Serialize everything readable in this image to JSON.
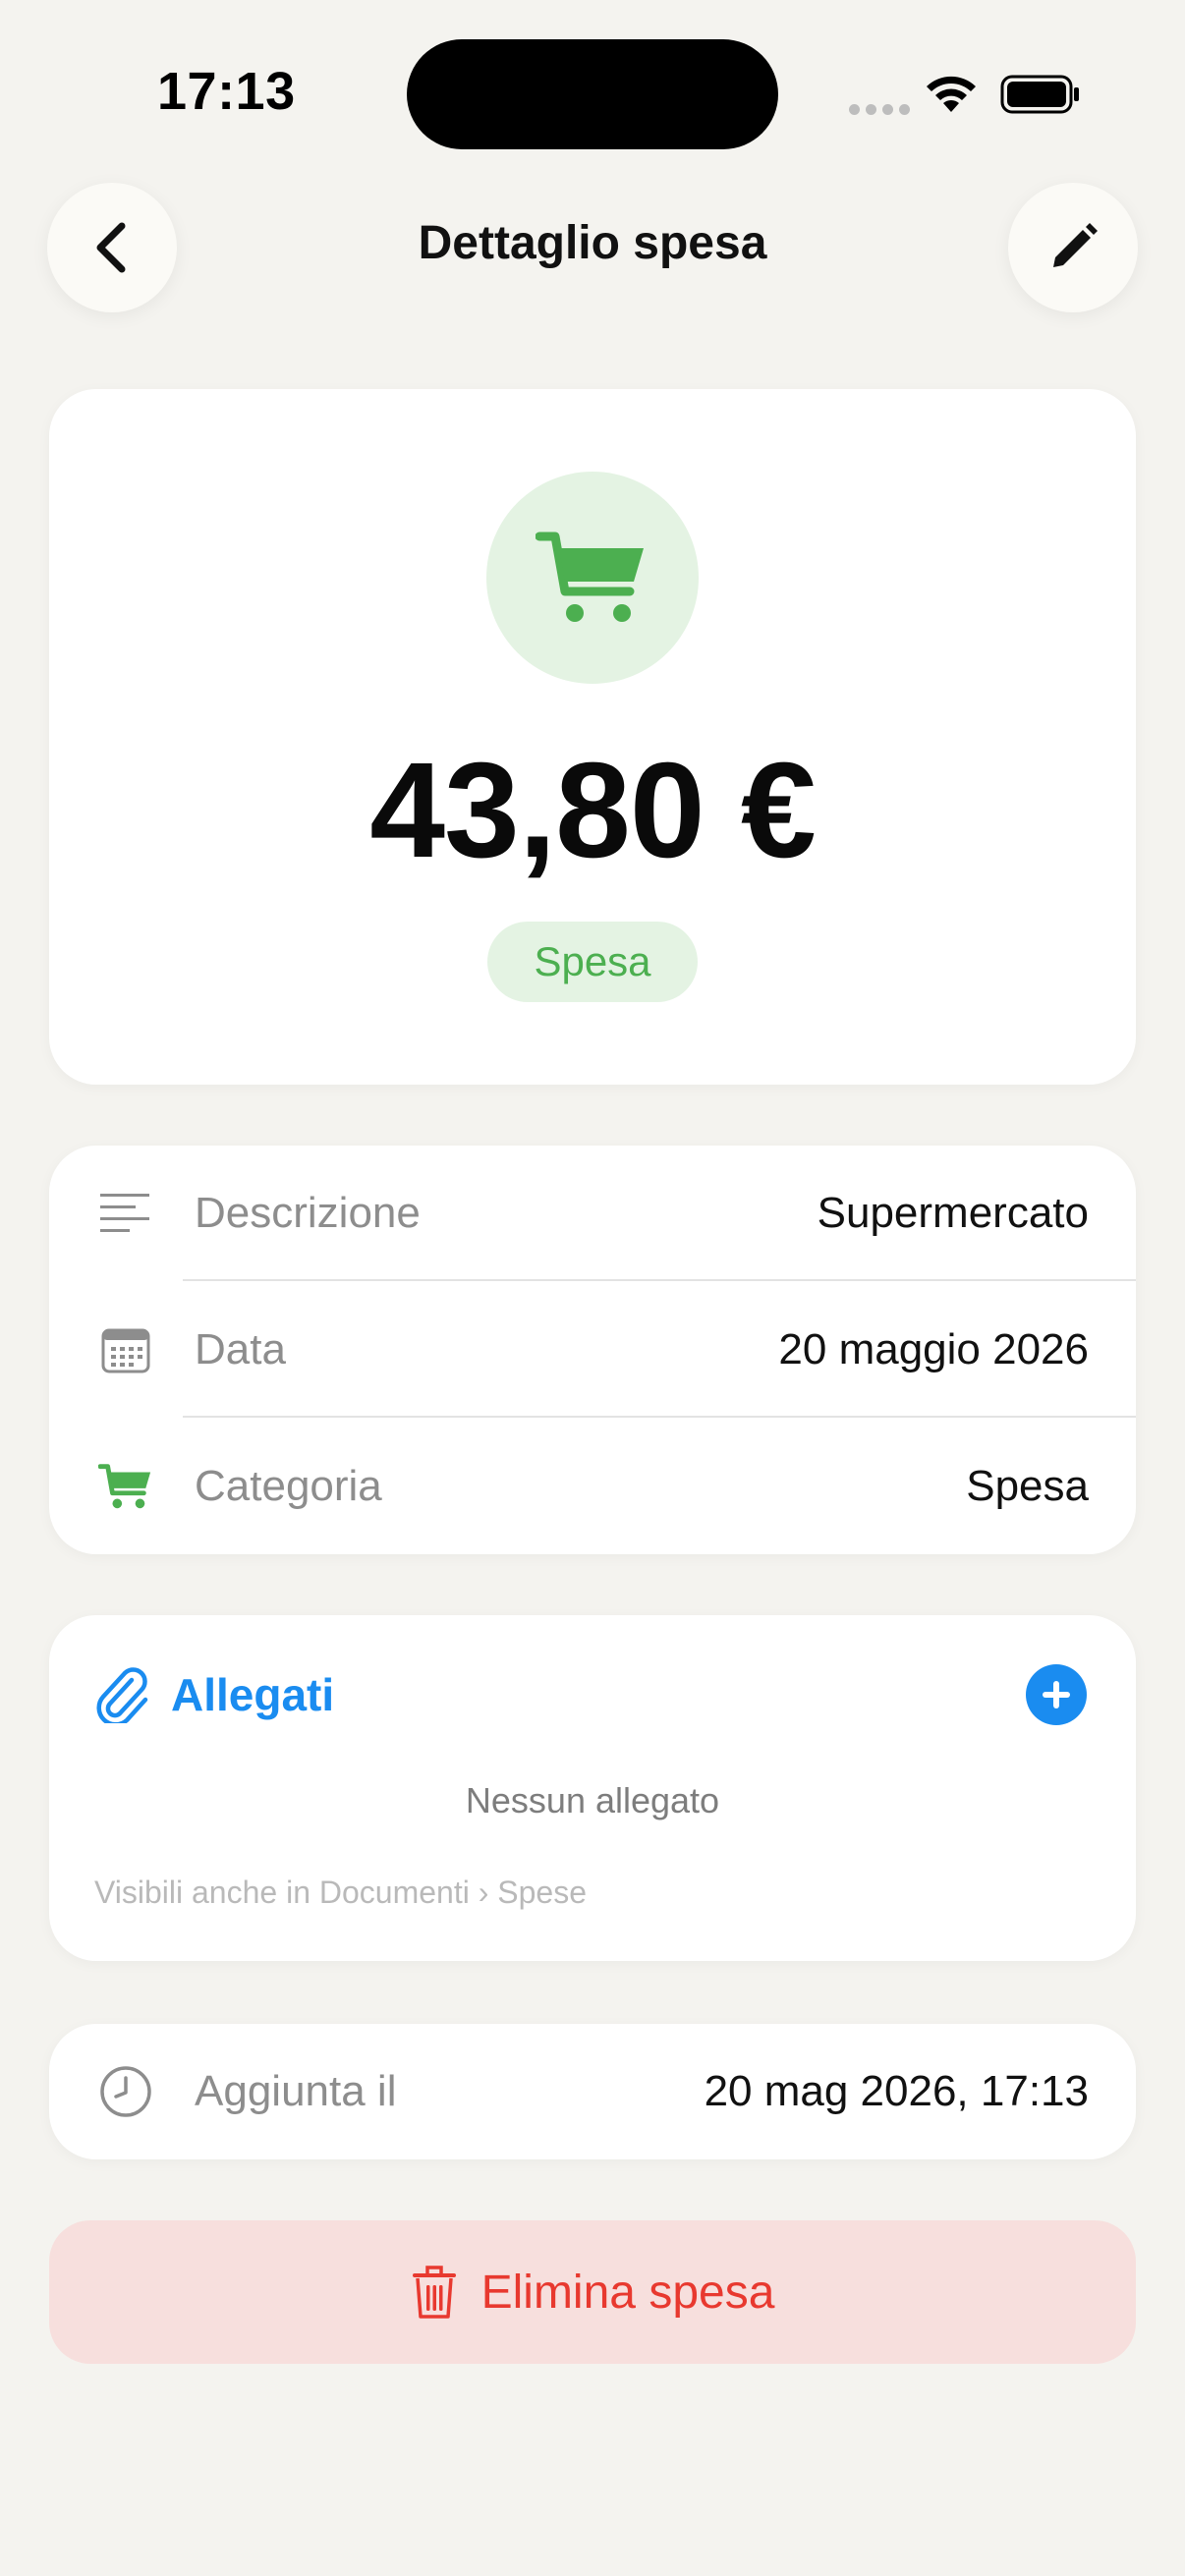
{
  "status_bar": {
    "time": "17:13"
  },
  "nav": {
    "title": "Dettaglio spesa"
  },
  "hero": {
    "amount": "43,80 €",
    "category_tag": "Spesa"
  },
  "details": {
    "rows": [
      {
        "label": "Descrizione",
        "value": "Supermercato"
      },
      {
        "label": "Data",
        "value": "20 maggio 2026"
      },
      {
        "label": "Categoria",
        "value": "Spesa"
      }
    ]
  },
  "attachments": {
    "title": "Allegati",
    "empty_text": "Nessun allegato",
    "hint": "Visibili anche in Documenti › Spese"
  },
  "added": {
    "label": "Aggiunta il",
    "value": "20 mag 2026, 17:13"
  },
  "delete": {
    "label": "Elimina spesa"
  },
  "colors": {
    "accent_blue": "#1a8cf0",
    "category_green": "#4caf50",
    "danger_red": "#e8392f",
    "background": "#f4f3ef"
  },
  "icons": {
    "back": "chevron-left-icon",
    "edit": "pencil-icon",
    "category": "cart-icon",
    "description": "lines-icon",
    "date": "calendar-icon",
    "attach": "paperclip-icon",
    "add": "plus-icon",
    "added": "clock-icon",
    "delete": "trash-icon"
  }
}
